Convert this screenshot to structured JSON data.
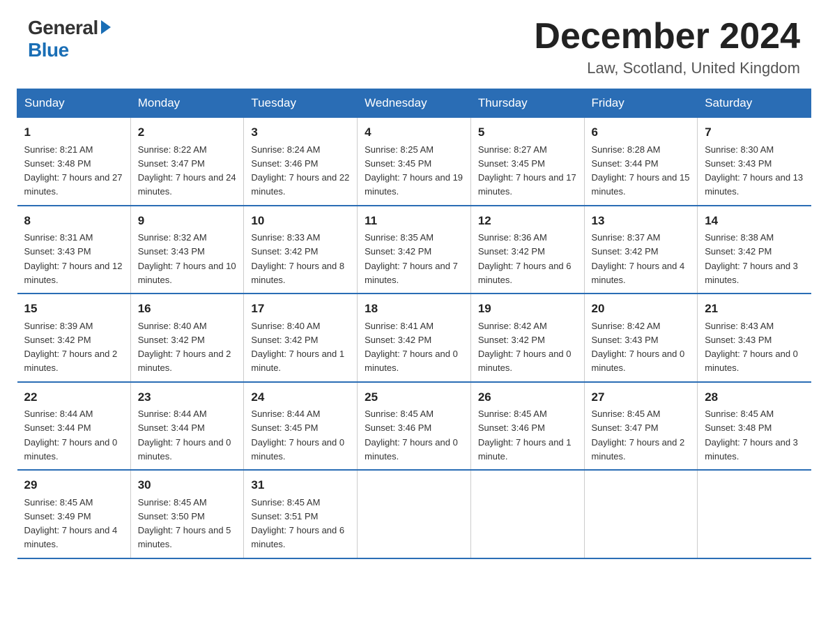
{
  "header": {
    "logo_general": "General",
    "logo_blue": "Blue",
    "month_title": "December 2024",
    "location": "Law, Scotland, United Kingdom"
  },
  "weekdays": [
    "Sunday",
    "Monday",
    "Tuesday",
    "Wednesday",
    "Thursday",
    "Friday",
    "Saturday"
  ],
  "weeks": [
    [
      {
        "day": "1",
        "sunrise": "8:21 AM",
        "sunset": "3:48 PM",
        "daylight": "7 hours and 27 minutes."
      },
      {
        "day": "2",
        "sunrise": "8:22 AM",
        "sunset": "3:47 PM",
        "daylight": "7 hours and 24 minutes."
      },
      {
        "day": "3",
        "sunrise": "8:24 AM",
        "sunset": "3:46 PM",
        "daylight": "7 hours and 22 minutes."
      },
      {
        "day": "4",
        "sunrise": "8:25 AM",
        "sunset": "3:45 PM",
        "daylight": "7 hours and 19 minutes."
      },
      {
        "day": "5",
        "sunrise": "8:27 AM",
        "sunset": "3:45 PM",
        "daylight": "7 hours and 17 minutes."
      },
      {
        "day": "6",
        "sunrise": "8:28 AM",
        "sunset": "3:44 PM",
        "daylight": "7 hours and 15 minutes."
      },
      {
        "day": "7",
        "sunrise": "8:30 AM",
        "sunset": "3:43 PM",
        "daylight": "7 hours and 13 minutes."
      }
    ],
    [
      {
        "day": "8",
        "sunrise": "8:31 AM",
        "sunset": "3:43 PM",
        "daylight": "7 hours and 12 minutes."
      },
      {
        "day": "9",
        "sunrise": "8:32 AM",
        "sunset": "3:43 PM",
        "daylight": "7 hours and 10 minutes."
      },
      {
        "day": "10",
        "sunrise": "8:33 AM",
        "sunset": "3:42 PM",
        "daylight": "7 hours and 8 minutes."
      },
      {
        "day": "11",
        "sunrise": "8:35 AM",
        "sunset": "3:42 PM",
        "daylight": "7 hours and 7 minutes."
      },
      {
        "day": "12",
        "sunrise": "8:36 AM",
        "sunset": "3:42 PM",
        "daylight": "7 hours and 6 minutes."
      },
      {
        "day": "13",
        "sunrise": "8:37 AM",
        "sunset": "3:42 PM",
        "daylight": "7 hours and 4 minutes."
      },
      {
        "day": "14",
        "sunrise": "8:38 AM",
        "sunset": "3:42 PM",
        "daylight": "7 hours and 3 minutes."
      }
    ],
    [
      {
        "day": "15",
        "sunrise": "8:39 AM",
        "sunset": "3:42 PM",
        "daylight": "7 hours and 2 minutes."
      },
      {
        "day": "16",
        "sunrise": "8:40 AM",
        "sunset": "3:42 PM",
        "daylight": "7 hours and 2 minutes."
      },
      {
        "day": "17",
        "sunrise": "8:40 AM",
        "sunset": "3:42 PM",
        "daylight": "7 hours and 1 minute."
      },
      {
        "day": "18",
        "sunrise": "8:41 AM",
        "sunset": "3:42 PM",
        "daylight": "7 hours and 0 minutes."
      },
      {
        "day": "19",
        "sunrise": "8:42 AM",
        "sunset": "3:42 PM",
        "daylight": "7 hours and 0 minutes."
      },
      {
        "day": "20",
        "sunrise": "8:42 AM",
        "sunset": "3:43 PM",
        "daylight": "7 hours and 0 minutes."
      },
      {
        "day": "21",
        "sunrise": "8:43 AM",
        "sunset": "3:43 PM",
        "daylight": "7 hours and 0 minutes."
      }
    ],
    [
      {
        "day": "22",
        "sunrise": "8:44 AM",
        "sunset": "3:44 PM",
        "daylight": "7 hours and 0 minutes."
      },
      {
        "day": "23",
        "sunrise": "8:44 AM",
        "sunset": "3:44 PM",
        "daylight": "7 hours and 0 minutes."
      },
      {
        "day": "24",
        "sunrise": "8:44 AM",
        "sunset": "3:45 PM",
        "daylight": "7 hours and 0 minutes."
      },
      {
        "day": "25",
        "sunrise": "8:45 AM",
        "sunset": "3:46 PM",
        "daylight": "7 hours and 0 minutes."
      },
      {
        "day": "26",
        "sunrise": "8:45 AM",
        "sunset": "3:46 PM",
        "daylight": "7 hours and 1 minute."
      },
      {
        "day": "27",
        "sunrise": "8:45 AM",
        "sunset": "3:47 PM",
        "daylight": "7 hours and 2 minutes."
      },
      {
        "day": "28",
        "sunrise": "8:45 AM",
        "sunset": "3:48 PM",
        "daylight": "7 hours and 3 minutes."
      }
    ],
    [
      {
        "day": "29",
        "sunrise": "8:45 AM",
        "sunset": "3:49 PM",
        "daylight": "7 hours and 4 minutes."
      },
      {
        "day": "30",
        "sunrise": "8:45 AM",
        "sunset": "3:50 PM",
        "daylight": "7 hours and 5 minutes."
      },
      {
        "day": "31",
        "sunrise": "8:45 AM",
        "sunset": "3:51 PM",
        "daylight": "7 hours and 6 minutes."
      },
      null,
      null,
      null,
      null
    ]
  ]
}
